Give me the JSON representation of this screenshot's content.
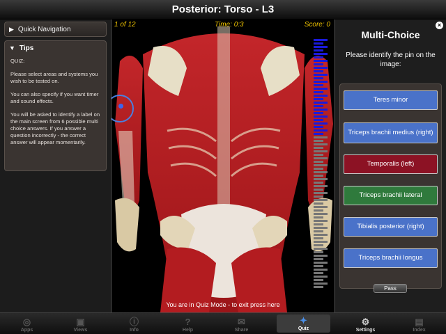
{
  "window": {
    "title": "Posterior: Torso - L3"
  },
  "left_panel": {
    "quick_nav_label": "Quick Navigation",
    "tips_label": "Tips",
    "tips_paragraphs": [
      "QUIZ:",
      "Please select areas and systems you wish to be tested on.",
      "You can also specify if you want timer and sound effects.",
      "You will be asked to identify a label on the main screen from 6 possible multi choice answers. If you answer a question incorrectly - the correct answer will appear momentarily."
    ]
  },
  "viewer": {
    "progress": "1 of 12",
    "time": "Time: 0:3",
    "score": "Score: 0",
    "mode_banner": "You are in Quiz Mode - to exit press here"
  },
  "quiz": {
    "title": "Multi-Choice",
    "prompt": "Please identify the pin on the image:",
    "answers": [
      {
        "label": "Teres minor",
        "color": "#4a72c9"
      },
      {
        "label": "Triceps brachii medius (right)",
        "color": "#4a72c9"
      },
      {
        "label": "Temporalis (left)",
        "color": "#8c1224"
      },
      {
        "label": "Triceps brachii lateral",
        "color": "#2f7a3c"
      },
      {
        "label": "Tibialis posterior (right)",
        "color": "#4a72c9"
      },
      {
        "label": "Triceps brachii longus",
        "color": "#4a72c9"
      }
    ],
    "pass_label": "Pass"
  },
  "tabbar": {
    "tabs": [
      {
        "label": "Apps",
        "icon": "apps-icon",
        "glyph": "◎"
      },
      {
        "label": "Views",
        "icon": "views-icon",
        "glyph": "▣"
      },
      {
        "label": "Info",
        "icon": "info-icon",
        "glyph": "ⓘ"
      },
      {
        "label": "Help",
        "icon": "help-icon",
        "glyph": "?"
      },
      {
        "label": "Share",
        "icon": "share-icon",
        "glyph": "✉"
      },
      {
        "label": "Quiz",
        "icon": "quiz-icon",
        "glyph": "✦"
      },
      {
        "label": "Settings",
        "icon": "settings-icon",
        "glyph": "⚙"
      },
      {
        "label": "Index",
        "icon": "index-icon",
        "glyph": "▤"
      }
    ],
    "active": "Quiz",
    "enabled": [
      "Quiz",
      "Settings"
    ]
  },
  "colors": {
    "highlight": "#f0c400",
    "pin": "#3b66f0"
  }
}
